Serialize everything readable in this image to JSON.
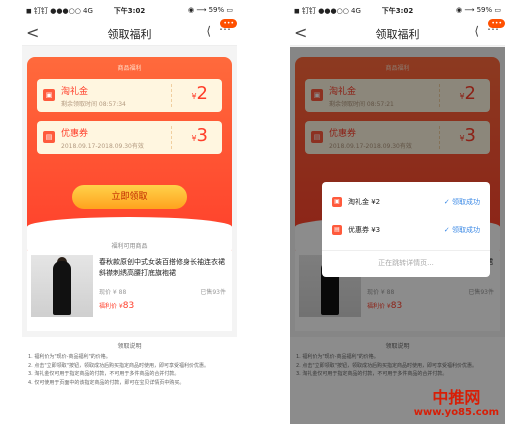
{
  "status": {
    "carrier": "◼ 钉钉 ●●●○○ 4G",
    "time": "下午3:02",
    "battery": "◉ ⟶ 59% ▭"
  },
  "nav": {
    "title": "领取福利",
    "back": "<",
    "badge": "•••"
  },
  "card": {
    "header": "商品福利",
    "coupons": [
      {
        "name": "淘礼金",
        "sub": "剩余领取时间 08:57:34",
        "sub_right": "剩余领取时间 08:57:21",
        "currency": "¥",
        "amount": "2",
        "icon": "gift-icon"
      },
      {
        "name": "优惠券",
        "sub": "2018.09.17-2018.09.30有效",
        "currency": "¥",
        "amount": "3",
        "icon": "ticket-icon"
      }
    ],
    "claim_button": "立即领取",
    "footer": "福利可用商品"
  },
  "product": {
    "title": "春秋款原创中式女装百搭修身长袖连衣裙斜襟刺绣高腰打底旗袍裙",
    "orig_price": "现价 ¥ 88",
    "sold": "已售93件",
    "price_label": "福利价 ¥",
    "price": "83"
  },
  "rules": {
    "title": "领取说明",
    "lines": [
      "1. 福利价为\"现价-商品福利\"的价格。",
      "2. 点击\"立即领取\"按钮，领取成功后购买指定商品时使用，即可享受福利价优惠。",
      "3. 淘礼金仅可用于指定商品的付款，不可用于多件商品的合并付款。",
      "4. 仅可使用于页面中的该指定商品的付款，即可在宝贝详情页中购买。"
    ]
  },
  "dialog": {
    "rows": [
      {
        "name": "淘礼金 ¥2",
        "status": "✓ 领取成功",
        "icon": "gift-icon"
      },
      {
        "name": "优惠券 ¥3",
        "status": "✓ 领取成功",
        "icon": "ticket-icon"
      }
    ],
    "footer": "正在跳转详情页..."
  },
  "watermark": {
    "line1": "中推网",
    "line2": "www.yo85.com"
  }
}
